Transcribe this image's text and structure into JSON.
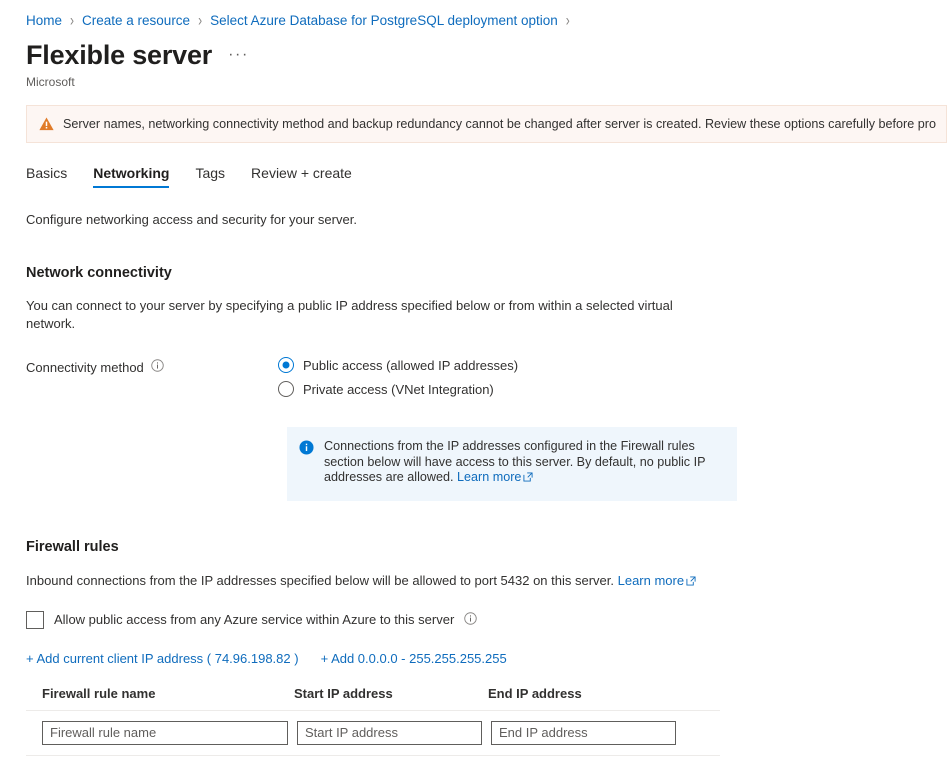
{
  "breadcrumb": {
    "items": [
      {
        "label": "Home"
      },
      {
        "label": "Create a resource"
      },
      {
        "label": "Select Azure Database for PostgreSQL deployment option"
      }
    ],
    "separator": "›"
  },
  "header": {
    "title": "Flexible server",
    "publisher": "Microsoft",
    "ellipsis": "···"
  },
  "warning": {
    "icon": "warning-triangle-icon",
    "text": "Server names, networking connectivity method and backup redundancy cannot be changed after server is created. Review these options carefully before provisioning"
  },
  "tabs": [
    {
      "label": "Basics",
      "active": false
    },
    {
      "label": "Networking",
      "active": true
    },
    {
      "label": "Tags",
      "active": false
    },
    {
      "label": "Review + create",
      "active": false
    }
  ],
  "main": {
    "intro": "Configure networking access and security for your server.",
    "network_connectivity": {
      "heading": "Network connectivity",
      "description": "You can connect to your server by specifying a public IP address specified below or from within a selected virtual network.",
      "connectivity_method_label": "Connectivity method",
      "options": [
        {
          "label": "Public access (allowed IP addresses)",
          "selected": true
        },
        {
          "label": "Private access (VNet Integration)",
          "selected": false
        }
      ],
      "info_box": {
        "text": "Connections from the IP addresses configured in the Firewall rules section below will have access to this server. By default, no public IP addresses are allowed. ",
        "link_label": "Learn more"
      }
    },
    "firewall_rules": {
      "heading": "Firewall rules",
      "description": "Inbound connections from the IP addresses specified below will be allowed to port 5432 on this server. ",
      "link_label": "Learn more",
      "allow_azure_services_label": "Allow public access from any Azure service within Azure to this server",
      "allow_azure_services_checked": false,
      "add_client_ip_label": "+ Add current client IP address ( 74.96.198.82 )",
      "add_all_ip_label": "+ Add 0.0.0.0 - 255.255.255.255",
      "table": {
        "columns": [
          "Firewall rule name",
          "Start IP address",
          "End IP address"
        ],
        "rows": [
          {
            "name_value": "",
            "name_placeholder": "Firewall rule name",
            "start_value": "",
            "start_placeholder": "Start IP address",
            "end_value": "",
            "end_placeholder": "End IP address"
          }
        ]
      }
    }
  },
  "colors": {
    "accent": "#0078d4",
    "link": "#0f6cbd",
    "warning_bg": "#fdf6f3",
    "warning_icon": "#d83b01",
    "info_bg": "#eff6fc",
    "info_icon": "#0078d4"
  }
}
